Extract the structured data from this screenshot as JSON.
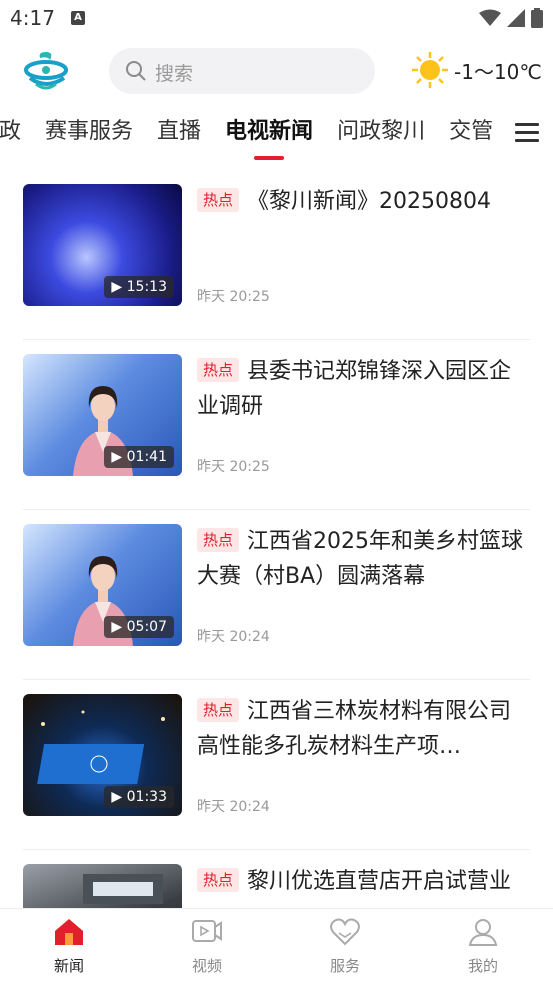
{
  "status": {
    "time": "4:17"
  },
  "header": {
    "search_placeholder": "搜索",
    "weather": {
      "icon": "sun-icon",
      "temp": "-1～10℃"
    }
  },
  "tabs": [
    {
      "label": "政",
      "active": false
    },
    {
      "label": "赛事服务",
      "active": false
    },
    {
      "label": "直播",
      "active": false
    },
    {
      "label": "电视新闻",
      "active": true
    },
    {
      "label": "问政黎川",
      "active": false
    },
    {
      "label": "交管",
      "active": false
    }
  ],
  "news": [
    {
      "badge": "热点",
      "title": "《黎川新闻》20250804",
      "time": "昨天 20:25",
      "duration": "15:13"
    },
    {
      "badge": "热点",
      "title": "县委书记郑锦锋深入园区企业调研",
      "time": "昨天 20:25",
      "duration": "01:41"
    },
    {
      "badge": "热点",
      "title": "江西省2025年和美乡村篮球大赛（村BA）圆满落幕",
      "time": "昨天 20:24",
      "duration": "05:07"
    },
    {
      "badge": "热点",
      "title": "江西省三林炭材料有限公司高性能多孔炭材料生产项…",
      "time": "昨天 20:24",
      "duration": "01:33"
    },
    {
      "badge": "热点",
      "title": "黎川优选直营店开启试营业",
      "time": "",
      "duration": ""
    }
  ],
  "bottom_nav": [
    {
      "label": "新闻",
      "icon": "home-icon",
      "active": true
    },
    {
      "label": "视频",
      "icon": "video-icon",
      "active": false
    },
    {
      "label": "服务",
      "icon": "heart-icon",
      "active": false
    },
    {
      "label": "我的",
      "icon": "user-icon",
      "active": false
    }
  ],
  "colors": {
    "accent": "#e0202a",
    "badge_bg": "#fde6e6"
  }
}
